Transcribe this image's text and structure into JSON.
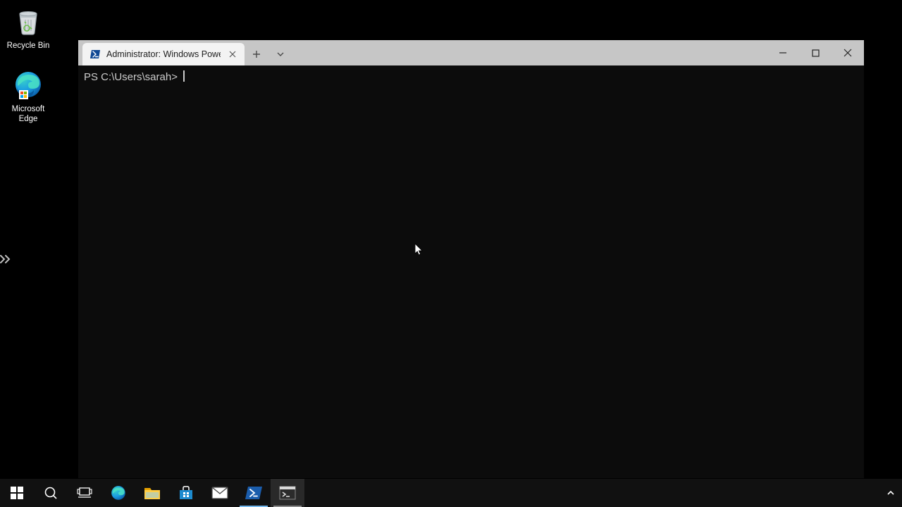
{
  "desktop": {
    "icons": [
      {
        "name": "recycle-bin",
        "label": "Recycle Bin"
      },
      {
        "name": "microsoft-edge",
        "label": "Microsoft Edge"
      }
    ]
  },
  "window": {
    "tab_title": "Administrator: Windows PowerShell",
    "terminal": {
      "prompt": "PS C:\\Users\\sarah> "
    }
  },
  "taskbar": {
    "items": [
      {
        "name": "start",
        "state": "idle"
      },
      {
        "name": "search",
        "state": "idle"
      },
      {
        "name": "task-view",
        "state": "idle"
      },
      {
        "name": "edge",
        "state": "idle"
      },
      {
        "name": "file-explorer",
        "state": "idle"
      },
      {
        "name": "store",
        "state": "idle"
      },
      {
        "name": "mail",
        "state": "idle"
      },
      {
        "name": "powershell",
        "state": "active"
      },
      {
        "name": "terminal",
        "state": "running"
      }
    ]
  }
}
